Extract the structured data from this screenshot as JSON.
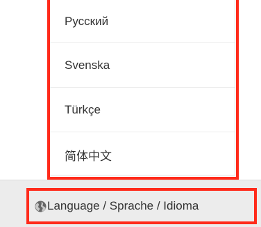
{
  "language_menu": {
    "items": [
      {
        "label": "Русский"
      },
      {
        "label": "Svenska"
      },
      {
        "label": "Türkçe"
      },
      {
        "label": "简体中文"
      }
    ]
  },
  "footer": {
    "language_toggle_label": "Language / Sprache / Idioma",
    "icon": "globe-icon"
  },
  "colors": {
    "highlight": "#ff2a1a",
    "footer_bg": "#ececec",
    "text": "#333333"
  }
}
